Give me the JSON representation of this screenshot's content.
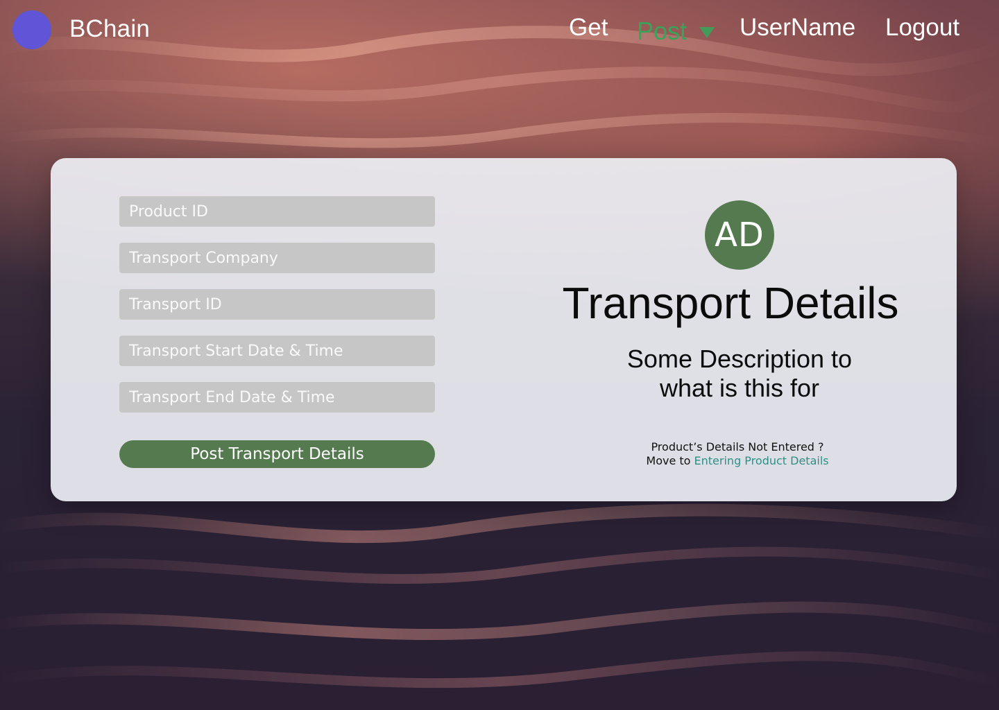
{
  "nav": {
    "brand": "BChain",
    "links": {
      "get": "Get",
      "post": "Post",
      "username": "UserName",
      "logout": "Logout"
    },
    "colors": {
      "logo_dot": "#5f55d6",
      "active_link": "#3aa35a"
    },
    "icons": {
      "post_dropdown": "chevron-down-icon"
    }
  },
  "card": {
    "form": {
      "fields": [
        {
          "placeholder": "Product ID",
          "value": ""
        },
        {
          "placeholder": "Transport Company",
          "value": ""
        },
        {
          "placeholder": "Transport ID",
          "value": ""
        },
        {
          "placeholder": "Transport Start Date & Time",
          "value": ""
        },
        {
          "placeholder": "Transport End Date & Time",
          "value": ""
        }
      ],
      "submit_label": "Post Transport Details",
      "colors": {
        "input_bg": "#c6c6c6",
        "primary": "#557a50"
      }
    },
    "right": {
      "avatar_initials": "AD",
      "title": "Transport Details",
      "description": "Some Description to\nwhat is this  for",
      "note_line1": "Product’s Details Not Entered ?",
      "note_prefix": "Move to ",
      "note_link": "Entering Product Details",
      "colors": {
        "link": "#2f8f86",
        "avatar": "#557a50"
      }
    }
  }
}
